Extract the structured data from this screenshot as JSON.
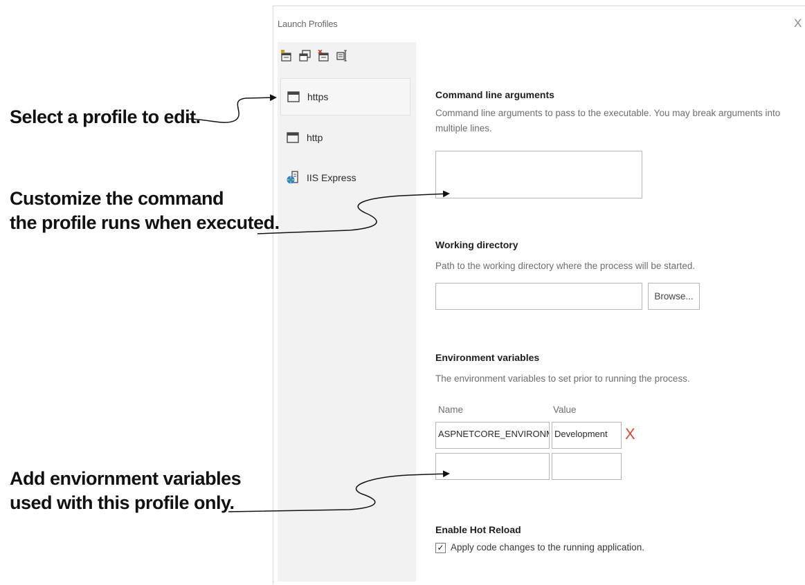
{
  "dialog": {
    "title": "Launch Profiles",
    "close_label": "X",
    "toolbar_icons": [
      "new-profile-icon",
      "copy-profile-icon",
      "delete-profile-icon",
      "rename-profile-icon"
    ],
    "profiles": [
      {
        "label": "https",
        "icon": "window-icon",
        "selected": true
      },
      {
        "label": "http",
        "icon": "window-icon",
        "selected": false
      },
      {
        "label": "IIS Express",
        "icon": "globe-server-icon",
        "selected": false
      }
    ]
  },
  "command_line": {
    "heading": "Command line arguments",
    "description": "Command line arguments to pass to the executable. You may break arguments into multiple lines.",
    "value": ""
  },
  "working_directory": {
    "heading": "Working directory",
    "description": "Path to the working directory where the process will be started.",
    "value": "",
    "browse_label": "Browse..."
  },
  "environment": {
    "heading": "Environment variables",
    "description": "The environment variables to set prior to running the process.",
    "col_name": "Name",
    "col_value": "Value",
    "rows": [
      {
        "name": "ASPNETCORE_ENVIRONMENT",
        "value": "Development",
        "delete": "X"
      },
      {
        "name": "",
        "value": ""
      }
    ],
    "delete_color": "#e0453a"
  },
  "hot_reload": {
    "heading": "Enable Hot Reload",
    "checkbox_label": "Apply code changes to the running application.",
    "checked": true,
    "check_glyph": "✓"
  },
  "annotations": {
    "select": "Select a profile to edit.",
    "customize_1": "Customize the command",
    "customize_2": "the profile runs when executed.",
    "env_1": "Add enviornment variables",
    "env_2": "used with this profile only."
  }
}
